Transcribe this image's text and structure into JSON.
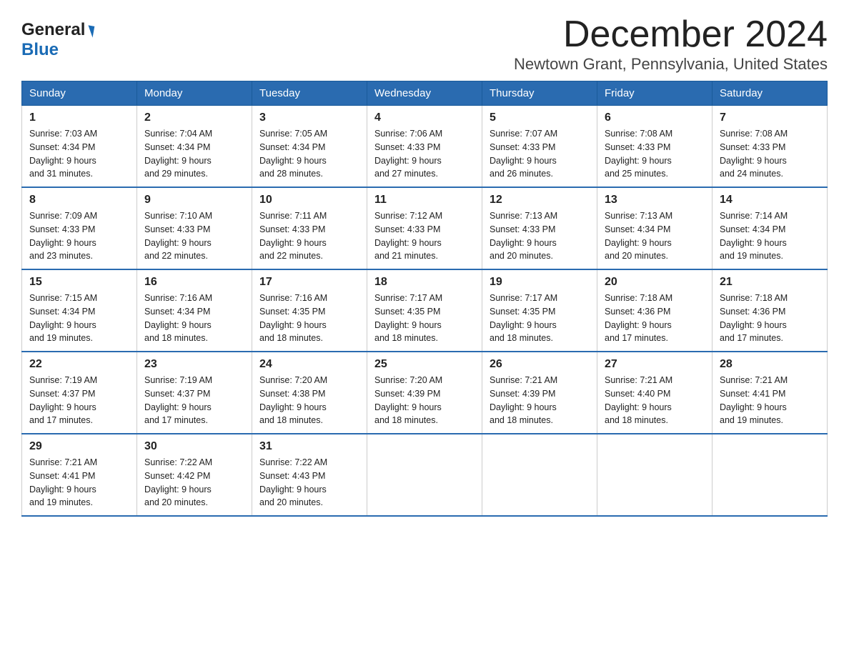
{
  "header": {
    "logo_general": "General",
    "logo_blue": "Blue",
    "month_title": "December 2024",
    "location": "Newtown Grant, Pennsylvania, United States"
  },
  "days_of_week": [
    "Sunday",
    "Monday",
    "Tuesday",
    "Wednesday",
    "Thursday",
    "Friday",
    "Saturday"
  ],
  "weeks": [
    [
      {
        "day": "1",
        "sunrise": "7:03 AM",
        "sunset": "4:34 PM",
        "daylight": "9 hours and 31 minutes."
      },
      {
        "day": "2",
        "sunrise": "7:04 AM",
        "sunset": "4:34 PM",
        "daylight": "9 hours and 29 minutes."
      },
      {
        "day": "3",
        "sunrise": "7:05 AM",
        "sunset": "4:34 PM",
        "daylight": "9 hours and 28 minutes."
      },
      {
        "day": "4",
        "sunrise": "7:06 AM",
        "sunset": "4:33 PM",
        "daylight": "9 hours and 27 minutes."
      },
      {
        "day": "5",
        "sunrise": "7:07 AM",
        "sunset": "4:33 PM",
        "daylight": "9 hours and 26 minutes."
      },
      {
        "day": "6",
        "sunrise": "7:08 AM",
        "sunset": "4:33 PM",
        "daylight": "9 hours and 25 minutes."
      },
      {
        "day": "7",
        "sunrise": "7:08 AM",
        "sunset": "4:33 PM",
        "daylight": "9 hours and 24 minutes."
      }
    ],
    [
      {
        "day": "8",
        "sunrise": "7:09 AM",
        "sunset": "4:33 PM",
        "daylight": "9 hours and 23 minutes."
      },
      {
        "day": "9",
        "sunrise": "7:10 AM",
        "sunset": "4:33 PM",
        "daylight": "9 hours and 22 minutes."
      },
      {
        "day": "10",
        "sunrise": "7:11 AM",
        "sunset": "4:33 PM",
        "daylight": "9 hours and 22 minutes."
      },
      {
        "day": "11",
        "sunrise": "7:12 AM",
        "sunset": "4:33 PM",
        "daylight": "9 hours and 21 minutes."
      },
      {
        "day": "12",
        "sunrise": "7:13 AM",
        "sunset": "4:33 PM",
        "daylight": "9 hours and 20 minutes."
      },
      {
        "day": "13",
        "sunrise": "7:13 AM",
        "sunset": "4:34 PM",
        "daylight": "9 hours and 20 minutes."
      },
      {
        "day": "14",
        "sunrise": "7:14 AM",
        "sunset": "4:34 PM",
        "daylight": "9 hours and 19 minutes."
      }
    ],
    [
      {
        "day": "15",
        "sunrise": "7:15 AM",
        "sunset": "4:34 PM",
        "daylight": "9 hours and 19 minutes."
      },
      {
        "day": "16",
        "sunrise": "7:16 AM",
        "sunset": "4:34 PM",
        "daylight": "9 hours and 18 minutes."
      },
      {
        "day": "17",
        "sunrise": "7:16 AM",
        "sunset": "4:35 PM",
        "daylight": "9 hours and 18 minutes."
      },
      {
        "day": "18",
        "sunrise": "7:17 AM",
        "sunset": "4:35 PM",
        "daylight": "9 hours and 18 minutes."
      },
      {
        "day": "19",
        "sunrise": "7:17 AM",
        "sunset": "4:35 PM",
        "daylight": "9 hours and 18 minutes."
      },
      {
        "day": "20",
        "sunrise": "7:18 AM",
        "sunset": "4:36 PM",
        "daylight": "9 hours and 17 minutes."
      },
      {
        "day": "21",
        "sunrise": "7:18 AM",
        "sunset": "4:36 PM",
        "daylight": "9 hours and 17 minutes."
      }
    ],
    [
      {
        "day": "22",
        "sunrise": "7:19 AM",
        "sunset": "4:37 PM",
        "daylight": "9 hours and 17 minutes."
      },
      {
        "day": "23",
        "sunrise": "7:19 AM",
        "sunset": "4:37 PM",
        "daylight": "9 hours and 17 minutes."
      },
      {
        "day": "24",
        "sunrise": "7:20 AM",
        "sunset": "4:38 PM",
        "daylight": "9 hours and 18 minutes."
      },
      {
        "day": "25",
        "sunrise": "7:20 AM",
        "sunset": "4:39 PM",
        "daylight": "9 hours and 18 minutes."
      },
      {
        "day": "26",
        "sunrise": "7:21 AM",
        "sunset": "4:39 PM",
        "daylight": "9 hours and 18 minutes."
      },
      {
        "day": "27",
        "sunrise": "7:21 AM",
        "sunset": "4:40 PM",
        "daylight": "9 hours and 18 minutes."
      },
      {
        "day": "28",
        "sunrise": "7:21 AM",
        "sunset": "4:41 PM",
        "daylight": "9 hours and 19 minutes."
      }
    ],
    [
      {
        "day": "29",
        "sunrise": "7:21 AM",
        "sunset": "4:41 PM",
        "daylight": "9 hours and 19 minutes."
      },
      {
        "day": "30",
        "sunrise": "7:22 AM",
        "sunset": "4:42 PM",
        "daylight": "9 hours and 20 minutes."
      },
      {
        "day": "31",
        "sunrise": "7:22 AM",
        "sunset": "4:43 PM",
        "daylight": "9 hours and 20 minutes."
      },
      null,
      null,
      null,
      null
    ]
  ]
}
